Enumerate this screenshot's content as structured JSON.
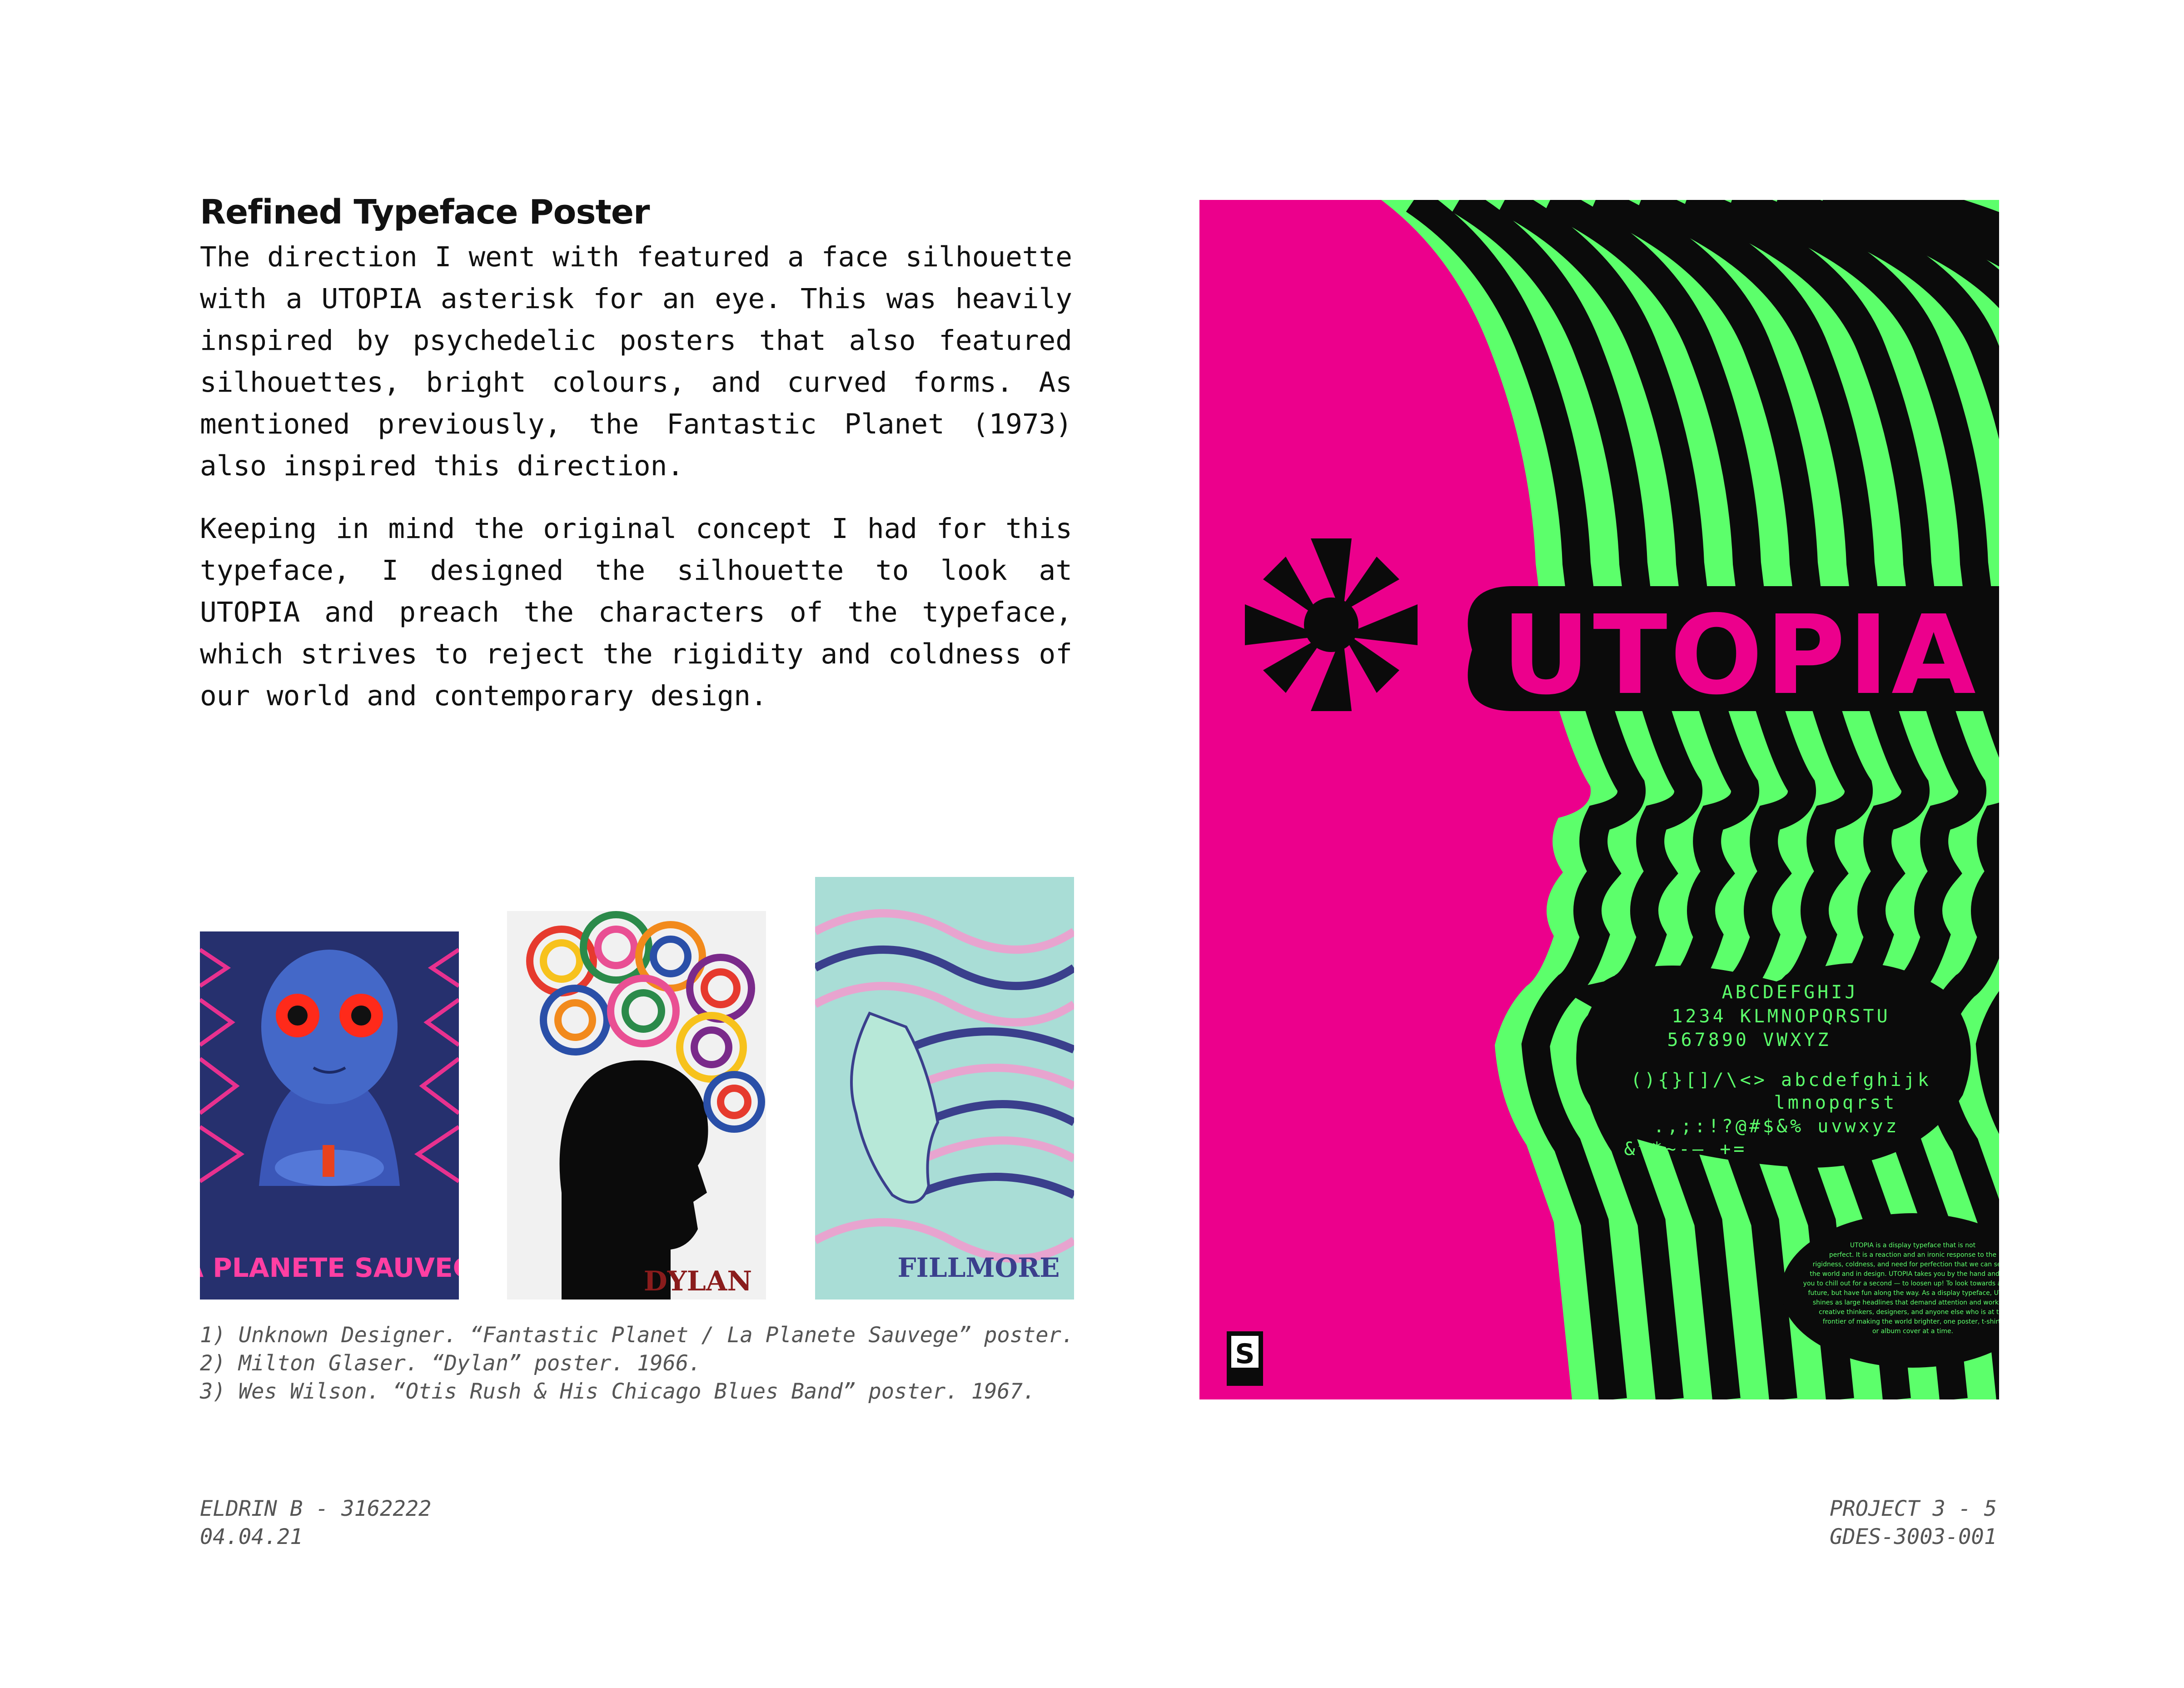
{
  "heading": "Refined Typeface Poster",
  "paragraphs": [
    "The direction I went with featured a face silhouette with a UTOPIA asterisk for an eye. This was heavily inspired by psychedelic posters that also featured silhouettes, bright colours, and curved forms. As mentioned previously, the Fantastic Planet (1973) also inspired this direction.",
    "Keeping in mind the original concept I had for this typeface, I designed the silhouette to look at UTOPIA and preach the characters of the typeface, which strives to reject the rigidity and coldness of our world and contemporary design."
  ],
  "thumbnails": {
    "fantastic_planet": {
      "poster_text": "LA PLANETE SAUVEGE"
    },
    "dylan": {
      "poster_text": "DYLAN"
    },
    "otis_rush": {
      "poster_text": "FILLMORE"
    }
  },
  "captions": [
    "1)  Unknown Designer. “Fantastic Planet / La Planete Sauvege” poster.",
    "2)  Milton Glaser. “Dylan” poster. 1966.",
    "3)  Wes Wilson. “Otis Rush & His Chicago Blues Band” poster. 1967."
  ],
  "footer": {
    "left": [
      "ELDRIN B - 3162222",
      "04.04.21"
    ],
    "right": [
      "PROJECT 3  -  5",
      "GDES-3003-001"
    ]
  },
  "poster": {
    "title": "UTOPIA",
    "glyph_lines": [
      "ABCDEFGHIJ",
      "1234  KLMNOPQRSTU",
      "567890  VWXYZ",
      "(){}[]/\\<>   abcdefghijk",
      "lmnopqrst",
      ".,;:!?@#$&%   uvwxyz",
      "&^*~-—_+="
    ],
    "blurb_lines": [
      "UTOPIA is a display typeface that is not",
      "perfect. It is a reaction and an ironic response to the",
      "rigidness, coldness, and need for perfection that we can see in",
      "the world and in design. UTOPIA takes you by the hand and asks",
      "you to chill out for a second — to loosen up! To look towards a bright",
      "future, but have fun along the way. As a display typeface, UTOPIA",
      "shines as large headlines that demand attention and works for",
      "creative thinkers, designers, and anyone else who is at the",
      "frontier of making the world brighter, one poster, t-shirt,",
      "or album cover at a time."
    ],
    "logo": "S",
    "colors": {
      "pink": "#ec008c",
      "green": "#5cff6b",
      "black": "#0b0b0b"
    }
  }
}
